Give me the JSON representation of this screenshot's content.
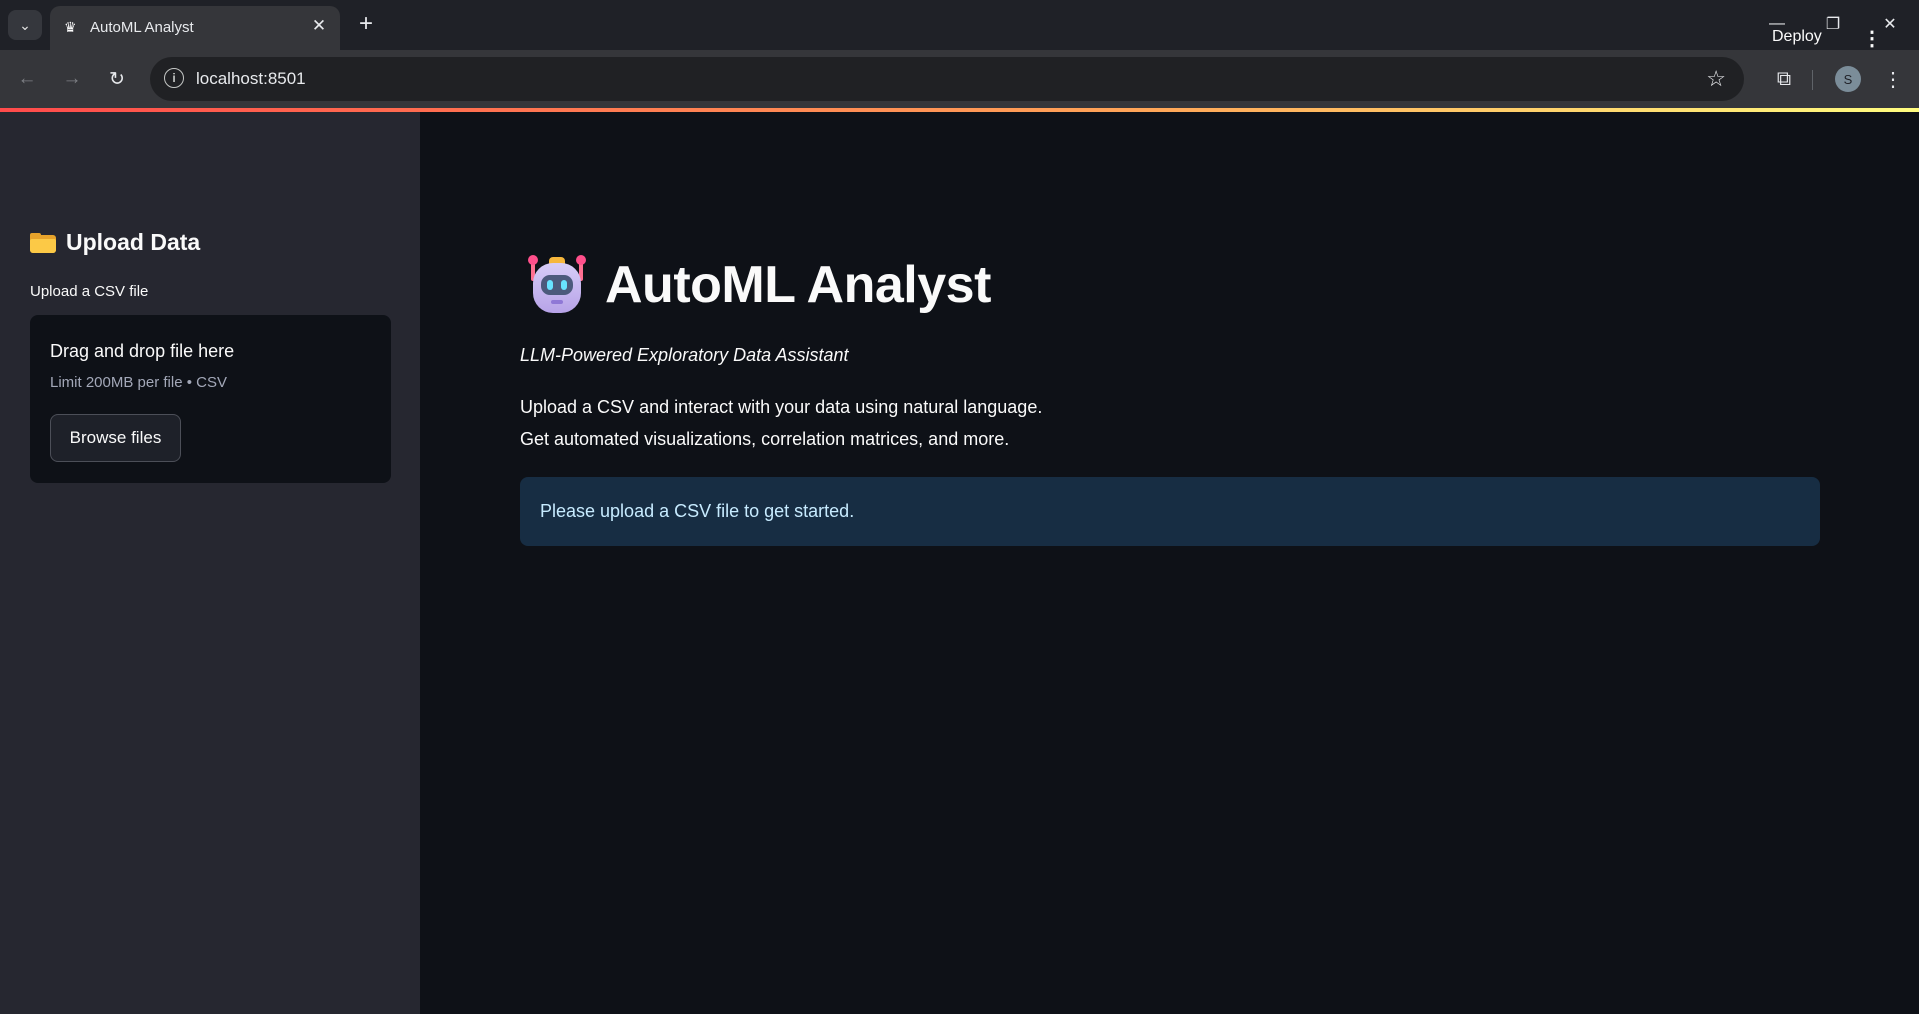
{
  "browser": {
    "tab_title": "AutoML Analyst",
    "url": "localhost:8501",
    "profile_initial": "S"
  },
  "icons": {
    "tab_search": "chevron-down-icon",
    "favicon": "streamlit-crown-icon",
    "site_info": "info-icon",
    "bookmark": "star-icon",
    "extensions": "puzzle-icon",
    "sidebar_header": "folder-icon",
    "app_title": "robot-icon",
    "main_menu": "kebab-menu-icon"
  },
  "sidebar": {
    "title": "Upload Data",
    "uploader": {
      "label": "Upload a CSV file",
      "drop_text": "Drag and drop file here",
      "limit_text": "Limit 200MB per file • CSV",
      "button_label": "Browse files"
    }
  },
  "header": {
    "deploy_label": "Deploy"
  },
  "main": {
    "title": "AutoML Analyst",
    "subtitle": "LLM-Powered Exploratory Data Assistant",
    "description_line1": "Upload a CSV and interact with your data using natural language.",
    "description_line2": "Get automated visualizations, correlation matrices, and more.",
    "info_message": "Please upload a CSV file to get started."
  },
  "colors": {
    "app_background": "#0e1117",
    "sidebar_background": "#262730",
    "info_background": "#172d43",
    "info_text": "#c7ebff",
    "accent_gradient_start": "#ff4b4b",
    "accent_gradient_end": "#fffd80"
  }
}
